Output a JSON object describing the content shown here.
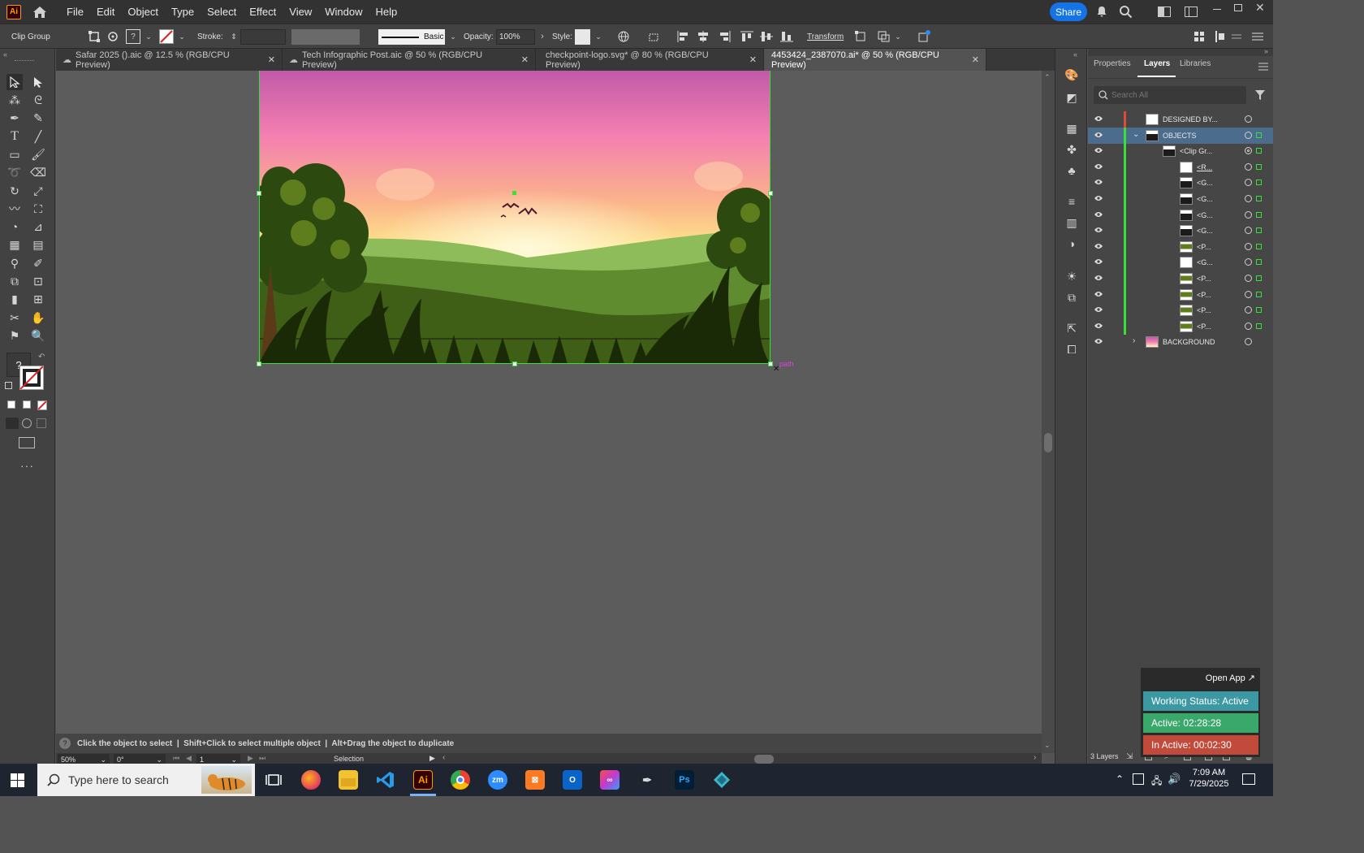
{
  "menu": {
    "app_icon": "Ai",
    "items": [
      "File",
      "Edit",
      "Object",
      "Type",
      "Select",
      "Effect",
      "View",
      "Window",
      "Help"
    ],
    "share_label": "Share"
  },
  "control_bar": {
    "selection_type": "Clip Group",
    "stroke_label": "Stroke:",
    "brush_label": "Basic",
    "opacity_label": "Opacity:",
    "opacity_value": "100%",
    "style_label": "Style:",
    "transform_label": "Transform"
  },
  "tabs": [
    {
      "label": "Safar 2025 ().aic @ 12.5 % (RGB/CPU Preview)",
      "cloud": true
    },
    {
      "label": "Tech Infographic Post.aic @ 50 % (RGB/CPU Preview)",
      "cloud": true
    },
    {
      "label": "checkpoint-logo.svg* @ 80 % (RGB/CPU Preview)",
      "cloud": false
    },
    {
      "label": "4453424_2387070.ai* @ 50 % (RGB/CPU Preview)",
      "cloud": false,
      "active": true
    }
  ],
  "canvas": {
    "hover_label": "path"
  },
  "status": {
    "hint": "Click the object to select  |  Shift+Click to select multiple object  |  Alt+Drag the object to duplicate",
    "zoom": "50%",
    "rotation": "0°",
    "artboard_number": "1",
    "mode": "Selection"
  },
  "panel": {
    "tabs": [
      "Properties",
      "Layers",
      "Libraries"
    ],
    "active_tab": "Layers",
    "search_placeholder": "Search All",
    "footer_count": "3 Layers",
    "rows": [
      {
        "name": "DESIGNED BY...",
        "color": "#e04a3a",
        "indent": 0,
        "expand": "",
        "thumb": "white"
      },
      {
        "name": "OBJECTS",
        "color": "#3ae03a",
        "indent": 0,
        "expand": "open",
        "thumb": "scene",
        "selected": true
      },
      {
        "name": "<Clip Gr...",
        "color": "#3ae03a",
        "indent": 1,
        "expand": "open",
        "thumb": "scene"
      },
      {
        "name": "<R...",
        "color": "#3ae03a",
        "indent": 2,
        "expand": "",
        "thumb": "white",
        "underline": true
      },
      {
        "name": "<G...",
        "color": "#3ae03a",
        "indent": 2,
        "expand": "closed",
        "thumb": "scene"
      },
      {
        "name": "<G...",
        "color": "#3ae03a",
        "indent": 2,
        "expand": "closed",
        "thumb": "scene"
      },
      {
        "name": "<G...",
        "color": "#3ae03a",
        "indent": 2,
        "expand": "closed",
        "thumb": "scene"
      },
      {
        "name": "<G...",
        "color": "#3ae03a",
        "indent": 2,
        "expand": "closed",
        "thumb": "scene"
      },
      {
        "name": "<P...",
        "color": "#3ae03a",
        "indent": 2,
        "expand": "",
        "thumb": "green"
      },
      {
        "name": "<G...",
        "color": "#3ae03a",
        "indent": 2,
        "expand": "closed",
        "thumb": "white"
      },
      {
        "name": "<P...",
        "color": "#3ae03a",
        "indent": 2,
        "expand": "",
        "thumb": "green"
      },
      {
        "name": "<P...",
        "color": "#3ae03a",
        "indent": 2,
        "expand": "",
        "thumb": "green"
      },
      {
        "name": "<P...",
        "color": "#3ae03a",
        "indent": 2,
        "expand": "",
        "thumb": "green"
      },
      {
        "name": "<P...",
        "color": "#3ae03a",
        "indent": 2,
        "expand": "",
        "thumb": "green"
      },
      {
        "name": "BACKGROUND",
        "color": "",
        "indent": 0,
        "expand": "closed",
        "thumb": "gradient"
      }
    ]
  },
  "tracker": {
    "open_app": "Open App ↗",
    "working_status": "Working Status: Active",
    "active": "Active: 02:28:28",
    "inactive": "In Active: 00:02:30"
  },
  "taskbar": {
    "search_placeholder": "Type here to search",
    "time": "7:09 AM",
    "date": "7/29/2025",
    "apps": [
      "task-view",
      "firefox",
      "file-explorer",
      "vscode",
      "illustrator",
      "chrome",
      "zoom",
      "xampp",
      "outlook",
      "creative-cloud",
      "pen-tool",
      "photoshop",
      "app-diamond"
    ]
  },
  "colors": {
    "accent": "#1473e6",
    "layer_green": "#3ae03a",
    "layer_red": "#e04a3a",
    "status_active": "#3aa86b",
    "status_inactive": "#c24a3a",
    "status_working": "#3c99a3"
  }
}
